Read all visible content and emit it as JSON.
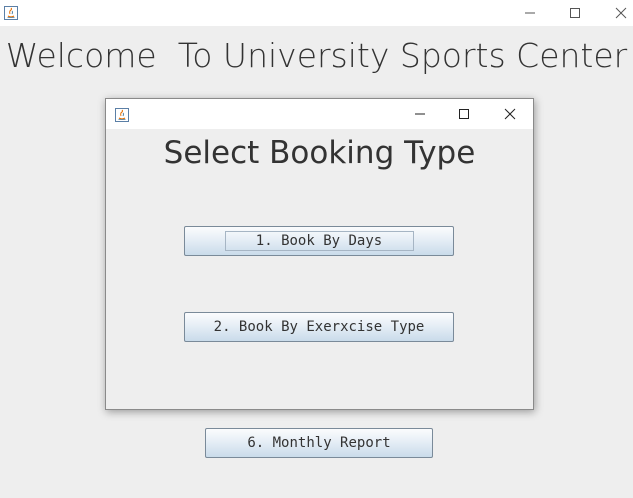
{
  "main_window": {
    "icon": "java-icon",
    "controls": [
      "minimize-icon",
      "maximize-icon",
      "close-icon"
    ],
    "welcome_title": "Welcome  To University Sports Center"
  },
  "dialog": {
    "icon": "java-icon",
    "controls": [
      "minimize-icon",
      "maximize-icon",
      "close-icon"
    ],
    "heading": "Select Booking Type",
    "buttons": {
      "book_by_days": "1. Book By Days",
      "book_by_exercise": "2. Book By Exerxcise Type"
    }
  },
  "background_buttons": {
    "monthly_report": "6. Monthly Report"
  },
  "colors": {
    "background": "#eeeeee",
    "titlebar": "#ffffff",
    "text": "#333333",
    "button_border": "#7a8a99"
  }
}
